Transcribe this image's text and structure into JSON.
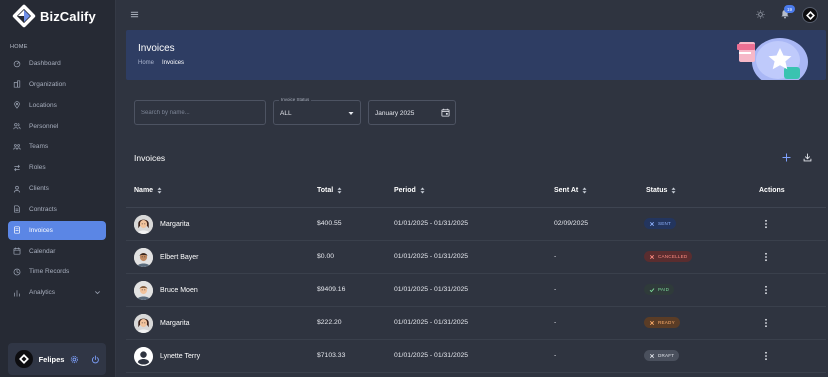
{
  "app": {
    "name": "BizCalify"
  },
  "sidebar": {
    "section_label": "HOME",
    "items": [
      {
        "label": "Dashboard",
        "icon": "dashboard-icon",
        "active": false
      },
      {
        "label": "Organization",
        "icon": "organization-icon",
        "active": false
      },
      {
        "label": "Locations",
        "icon": "location-icon",
        "active": false
      },
      {
        "label": "Personnel",
        "icon": "personnel-icon",
        "active": false
      },
      {
        "label": "Teams",
        "icon": "teams-icon",
        "active": false
      },
      {
        "label": "Roles",
        "icon": "roles-icon",
        "active": false
      },
      {
        "label": "Clients",
        "icon": "clients-icon",
        "active": false
      },
      {
        "label": "Contracts",
        "icon": "contracts-icon",
        "active": false
      },
      {
        "label": "Invoices",
        "icon": "invoices-icon",
        "active": true
      },
      {
        "label": "Calendar",
        "icon": "calendar-icon",
        "active": false
      },
      {
        "label": "Time Records",
        "icon": "clock-icon",
        "active": false
      },
      {
        "label": "Analytics",
        "icon": "analytics-icon",
        "active": false,
        "has_submenu": true
      }
    ],
    "user": {
      "name": "Felipes"
    }
  },
  "topbar": {
    "notification_count": "19"
  },
  "banner": {
    "title": "Invoices",
    "breadcrumb": [
      "Home",
      "Invoices"
    ]
  },
  "filters": {
    "search_placeholder": "Search by name...",
    "status_label": "Invoice Status",
    "status_value": "ALL",
    "period_value": "January 2025"
  },
  "table": {
    "title": "Invoices",
    "columns": [
      "Name",
      "Total",
      "Period",
      "Sent At",
      "Status",
      "Actions"
    ],
    "rows": [
      {
        "name": "Margarita",
        "avatar": "female",
        "total": "$400.55",
        "period": "01/01/2025 - 01/31/2025",
        "sent_at": "02/09/2025",
        "status": "SENT"
      },
      {
        "name": "Elbert Bayer",
        "avatar": "male-dark",
        "total": "$0.00",
        "period": "01/01/2025 - 01/31/2025",
        "sent_at": "-",
        "status": "CANCELLED"
      },
      {
        "name": "Bruce Moen",
        "avatar": "male-light",
        "total": "$9409.16",
        "period": "01/01/2025 - 01/31/2025",
        "sent_at": "-",
        "status": "PAID"
      },
      {
        "name": "Margarita",
        "avatar": "female",
        "total": "$222.20",
        "period": "01/01/2025 - 01/31/2025",
        "sent_at": "-",
        "status": "READY"
      },
      {
        "name": "Lynette Terry",
        "avatar": "placeholder",
        "total": "$7103.33",
        "period": "01/01/2025 - 01/31/2025",
        "sent_at": "-",
        "status": "DRAFT"
      }
    ]
  },
  "status_colors": {
    "SENT": {
      "bg": "#23355e",
      "fg": "#8fb2ff",
      "icon": "x"
    },
    "CANCELLED": {
      "bg": "#5a2d2f",
      "fg": "#ff8a80",
      "icon": "x"
    },
    "PAID": {
      "bg": "#2f3b3a",
      "fg": "#7ddb9a",
      "icon": "check"
    },
    "READY": {
      "bg": "#5a3c26",
      "fg": "#ffae6b",
      "icon": "x"
    },
    "DRAFT": {
      "bg": "#4a505d",
      "fg": "#e3e6ec",
      "icon": "x"
    }
  },
  "colors": {
    "accent": "#5b86e5",
    "banner": "#2e3d63",
    "background": "#2f3440"
  }
}
